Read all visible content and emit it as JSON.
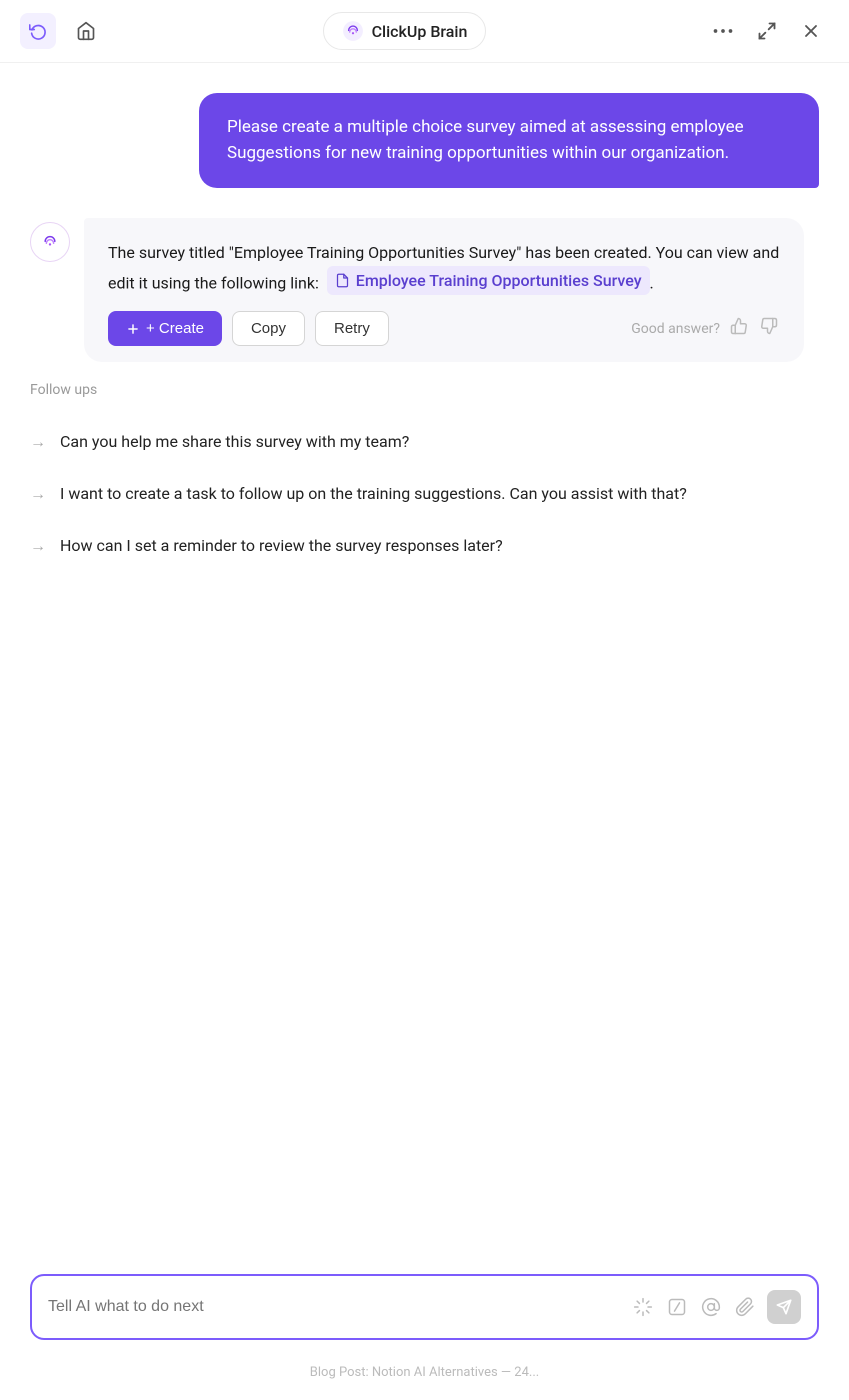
{
  "header": {
    "history_icon": "↺",
    "home_icon": "⌂",
    "title": "ClickUp Brain",
    "more_icon": "•••",
    "expand_icon": "⤢",
    "close_icon": "✕"
  },
  "user_message": {
    "text": "Please create a multiple choice survey aimed at assessing employee Suggestions for new training opportunities within our organization."
  },
  "ai_response": {
    "text_before": "The survey titled \"Employee Training Opportunities Survey\" has been created. You can view and edit it using the following link:",
    "link_text": "Employee Training Opportunities Survey",
    "text_after": ".",
    "actions": {
      "create_label": "+ Create",
      "copy_label": "Copy",
      "retry_label": "Retry",
      "good_answer_label": "Good answer?"
    }
  },
  "followups": {
    "label": "Follow ups",
    "items": [
      {
        "text": "Can you help me share this survey with my team?"
      },
      {
        "text": "I want to create a task to follow up on the training suggestions. Can you assist with that?"
      },
      {
        "text": "How can I set a reminder to review the survey responses later?"
      }
    ]
  },
  "input": {
    "placeholder": "Tell AI what to do next"
  },
  "bottom_hint": "Blog Post: Notion AI Alternatives — 24..."
}
